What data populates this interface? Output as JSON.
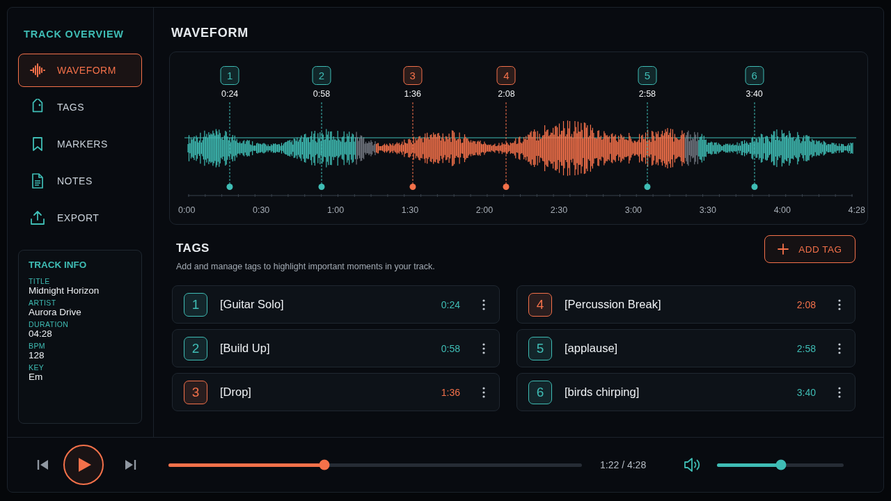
{
  "sidebar": {
    "title": "TRACK OVERVIEW",
    "items": [
      {
        "kind": "waveform",
        "label": "WAVEFORM",
        "selected": true
      },
      {
        "kind": "tag",
        "label": "TAGS",
        "selected": false
      },
      {
        "kind": "bookmark",
        "label": "MARKERS",
        "selected": false
      },
      {
        "kind": "document",
        "label": "NOTES",
        "selected": false
      },
      {
        "kind": "upload",
        "label": "EXPORT",
        "selected": false
      }
    ],
    "track_info": {
      "title": "TRACK INFO",
      "fields": [
        {
          "label": "TITLE",
          "value": "Midnight Horizon"
        },
        {
          "label": "ARTIST",
          "value": "Aurora Drive"
        },
        {
          "label": "DURATION",
          "value": "04:28"
        },
        {
          "label": "BPM",
          "value": "128"
        },
        {
          "label": "KEY",
          "value": "Em"
        }
      ]
    }
  },
  "waveform": {
    "title": "WAVEFORM",
    "markers": [
      {
        "number": "1",
        "time": "0:24",
        "color": "#3fbdb5"
      },
      {
        "number": "2",
        "time": "0:58",
        "color": "#3fbdb5"
      },
      {
        "number": "3",
        "time": "1:36",
        "color": "#f4714a"
      },
      {
        "number": "4",
        "time": "2:08",
        "color": "#f4714a"
      },
      {
        "number": "5",
        "time": "2:58",
        "color": "#3fbdb5"
      },
      {
        "number": "6",
        "time": "3:40",
        "color": "#3fbdb5"
      }
    ],
    "axis_labels": [
      "0:00",
      "0:30",
      "1:00",
      "1:30",
      "2:00",
      "2:30",
      "3:00",
      "3:30",
      "4:00",
      "4:28"
    ]
  },
  "tags": {
    "title": "TAGS",
    "subtitle": "Add and manage tags to highlight important moments in your track.",
    "add_button": "ADD TAG",
    "items": [
      {
        "number": "1",
        "label": "[Guitar Solo]",
        "time": "0:24",
        "color": "#3fbdb5"
      },
      {
        "number": "2",
        "label": "[Build Up]",
        "time": "0:58",
        "color": "#3fbdb5"
      },
      {
        "number": "3",
        "label": "[Drop]",
        "time": "1:36",
        "color": "#f4714a"
      },
      {
        "number": "4",
        "label": "[Percussion Break]",
        "time": "2:08",
        "color": "#f4714a"
      },
      {
        "number": "5",
        "label": "[applause]",
        "time": "2:58",
        "color": "#3fbdb5"
      },
      {
        "number": "6",
        "label": "[birds chirping]",
        "time": "3:40",
        "color": "#3fbdb5"
      }
    ]
  },
  "player": {
    "progress": {
      "level": 0.377
    },
    "time": "1:22 / 4:28",
    "volume": {
      "level": 0.505
    }
  }
}
